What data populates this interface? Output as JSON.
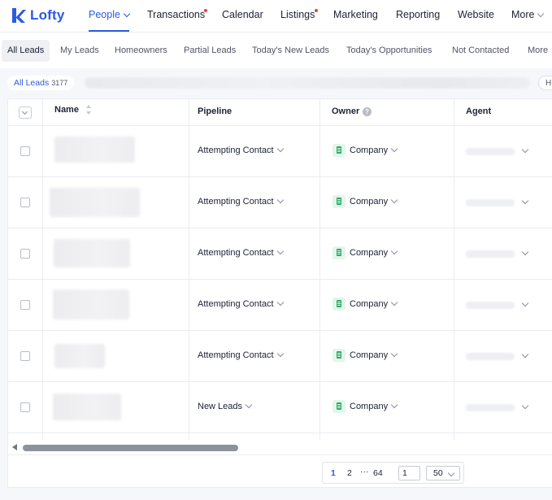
{
  "brand": {
    "name": "Lofty",
    "color": "#2b5be0"
  },
  "nav": {
    "items": [
      {
        "label": "People",
        "active": true,
        "dropdown": true
      },
      {
        "label": "Transactions",
        "dot": true
      },
      {
        "label": "Calendar"
      },
      {
        "label": "Listings",
        "dot": true
      },
      {
        "label": "Marketing"
      },
      {
        "label": "Reporting"
      },
      {
        "label": "Website"
      },
      {
        "label": "More",
        "dropdown": true
      }
    ]
  },
  "subnav": {
    "tabs": [
      {
        "label": "All Leads",
        "active": true
      },
      {
        "label": "My Leads"
      },
      {
        "label": "Homeowners"
      },
      {
        "label": "Partial Leads"
      },
      {
        "label": "Today's New Leads"
      },
      {
        "label": "Today's Opportunities"
      },
      {
        "label": "Not Contacted"
      },
      {
        "label": "More"
      }
    ]
  },
  "filter": {
    "label": "All Leads",
    "count": "3177",
    "right_chip": "H"
  },
  "table": {
    "columns": {
      "name": "Name",
      "pipeline": "Pipeline",
      "owner": "Owner",
      "agent": "Agent"
    },
    "owner_help": "?",
    "rows": [
      {
        "pipeline": "Attempting Contact",
        "owner": "Company"
      },
      {
        "pipeline": "Attempting Contact",
        "owner": "Company"
      },
      {
        "pipeline": "Attempting Contact",
        "owner": "Company"
      },
      {
        "pipeline": "Attempting Contact",
        "owner": "Company"
      },
      {
        "pipeline": "Attempting Contact",
        "owner": "Company"
      },
      {
        "pipeline": "New Leads",
        "owner": "Company"
      }
    ]
  },
  "pagination": {
    "pages": [
      "1",
      "2",
      "···",
      "64"
    ],
    "current": "1",
    "jump_value": "1",
    "page_size": "50"
  }
}
